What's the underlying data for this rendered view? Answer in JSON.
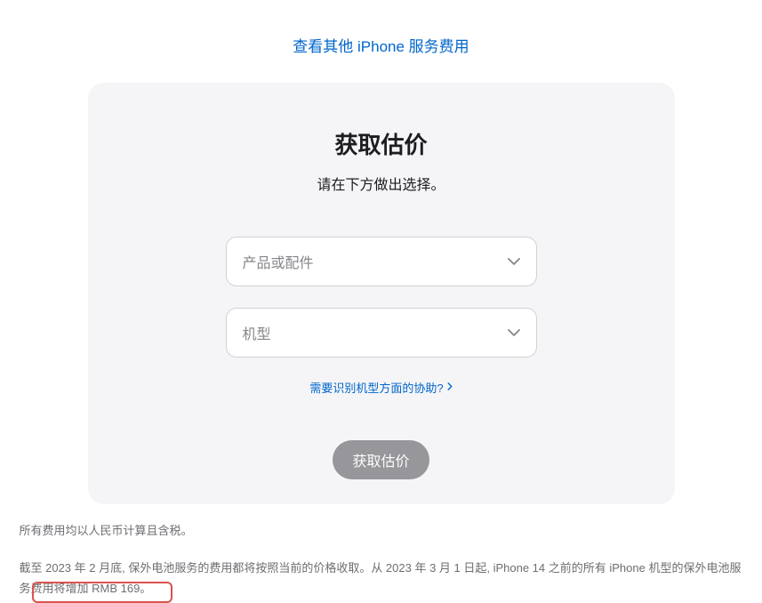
{
  "topLink": {
    "label": "查看其他 iPhone 服务费用"
  },
  "card": {
    "title": "获取估价",
    "subtitle": "请在下方做出选择。",
    "dropdown1Placeholder": "产品或配件",
    "dropdown2Placeholder": "机型",
    "helpLinkLabel": "需要识别机型方面的协助?",
    "buttonLabel": "获取估价"
  },
  "footer": {
    "line1": "所有费用均以人民币计算且含税。",
    "line2": "截至 2023 年 2 月底, 保外电池服务的费用都将按照当前的价格收取。从 2023 年 3 月 1 日起, iPhone 14 之前的所有 iPhone 机型的保外电池服务费用将增加 RMB 169。"
  }
}
